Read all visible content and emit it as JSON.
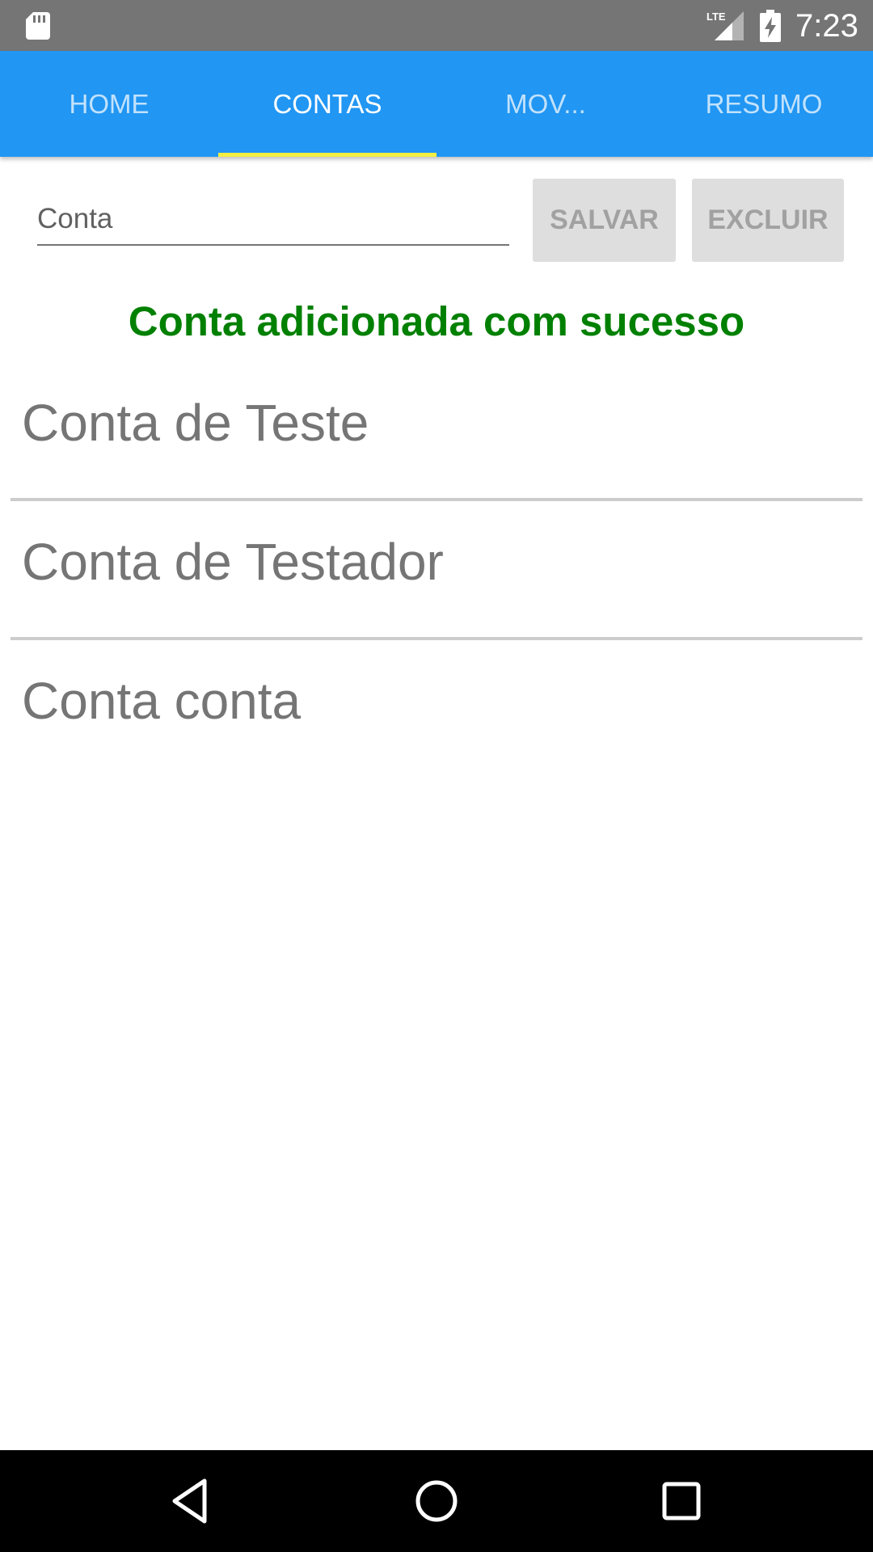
{
  "status_bar": {
    "time": "7:23",
    "network_label": "LTE",
    "icons": [
      "sd-card-icon",
      "signal-icon",
      "battery-charging-icon"
    ]
  },
  "tabs": [
    {
      "label": "HOME",
      "selected": false
    },
    {
      "label": "CONTAS",
      "selected": true
    },
    {
      "label": "MOV...",
      "selected": false
    },
    {
      "label": "RESUMO",
      "selected": false
    }
  ],
  "form": {
    "account_placeholder": "Conta",
    "save_label": "SALVAR",
    "delete_label": "EXCLUIR"
  },
  "success_message": "Conta adicionada com sucesso",
  "accounts": [
    {
      "name": "Conta de Teste"
    },
    {
      "name": "Conta de Testador"
    },
    {
      "name": "Conta conta"
    }
  ],
  "nav_bar": {
    "icons": [
      "back-icon",
      "home-icon",
      "recents-icon"
    ]
  },
  "colors": {
    "app_bar": "#2196F3",
    "tab_indicator": "#f4ee42",
    "success": "#008000",
    "status_bar": "#757575"
  }
}
